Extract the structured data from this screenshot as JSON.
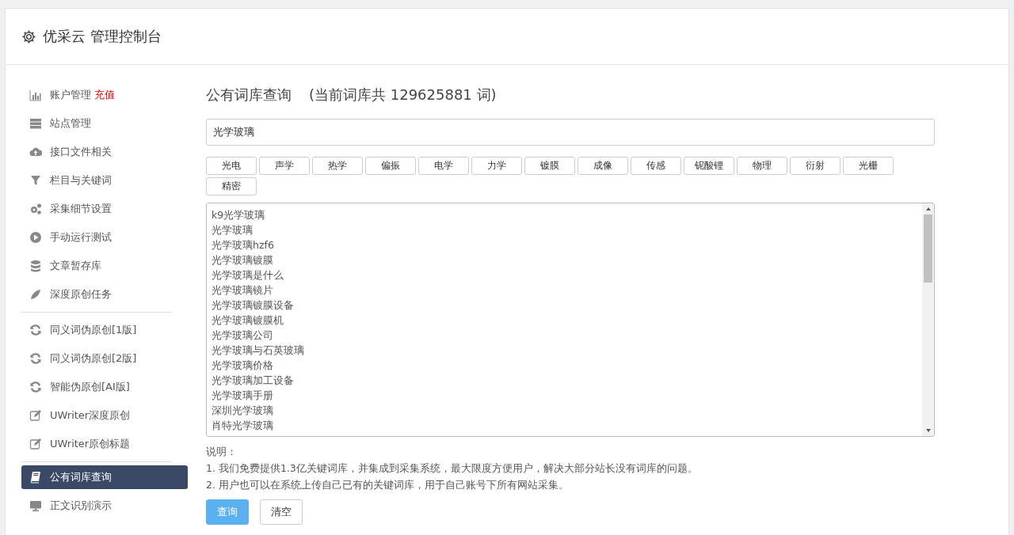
{
  "header": {
    "title": "优采云 管理控制台"
  },
  "sidebar": {
    "groups": [
      [
        {
          "label": "账户管理",
          "badge": "充值",
          "selected": false
        },
        {
          "label": "站点管理",
          "selected": false
        },
        {
          "label": "接口文件相关",
          "selected": false
        },
        {
          "label": "栏目与关键词",
          "selected": false
        },
        {
          "label": "采集细节设置",
          "selected": false
        },
        {
          "label": "手动运行测试",
          "selected": false
        },
        {
          "label": "文章暂存库",
          "selected": false
        },
        {
          "label": "深度原创任务",
          "selected": false
        }
      ],
      [
        {
          "label": "同义词伪原创[1版]",
          "selected": false
        },
        {
          "label": "同义词伪原创[2版]",
          "selected": false
        },
        {
          "label": "智能伪原创[AI版]",
          "selected": false
        },
        {
          "label": "UWriter深度原创",
          "selected": false
        },
        {
          "label": "UWriter原创标题",
          "selected": false
        }
      ],
      [
        {
          "label": "公有词库查询",
          "selected": true
        },
        {
          "label": "正文识别演示",
          "selected": false
        }
      ]
    ]
  },
  "main": {
    "title": "公有词库查询",
    "count_text": "(当前词库共 129625881 词)",
    "search": {
      "value": "光学玻璃"
    },
    "tags": [
      "光电",
      "声学",
      "热学",
      "偏振",
      "电学",
      "力学",
      "镀膜",
      "成像",
      "传感",
      "铌酸锂",
      "物理",
      "衍射",
      "光栅",
      "精密"
    ],
    "results": [
      "k9光学玻璃",
      "光学玻璃",
      "光学玻璃hzf6",
      "光学玻璃镀膜",
      "光学玻璃是什么",
      "光学玻璃镜片",
      "光学玻璃镀膜设备",
      "光学玻璃镀膜机",
      "光学玻璃公司",
      "光学玻璃与石英玻璃",
      "光学玻璃价格",
      "光学玻璃加工设备",
      "光学玻璃手册",
      "深圳光学玻璃",
      "肖特光学玻璃"
    ],
    "notes": {
      "heading": "说明：",
      "lines": [
        "1. 我们免费提供1.3亿关键词库，并集成到采集系统，最大限度方便用户，解决大部分站长没有词库的问题。",
        "2. 用户也可以在系统上传自己已有的关键词库，用于自己账号下所有网站采集。"
      ]
    },
    "buttons": [
      {
        "label": "查询",
        "kind": "primary"
      },
      {
        "label": "清空",
        "kind": "default"
      }
    ]
  }
}
